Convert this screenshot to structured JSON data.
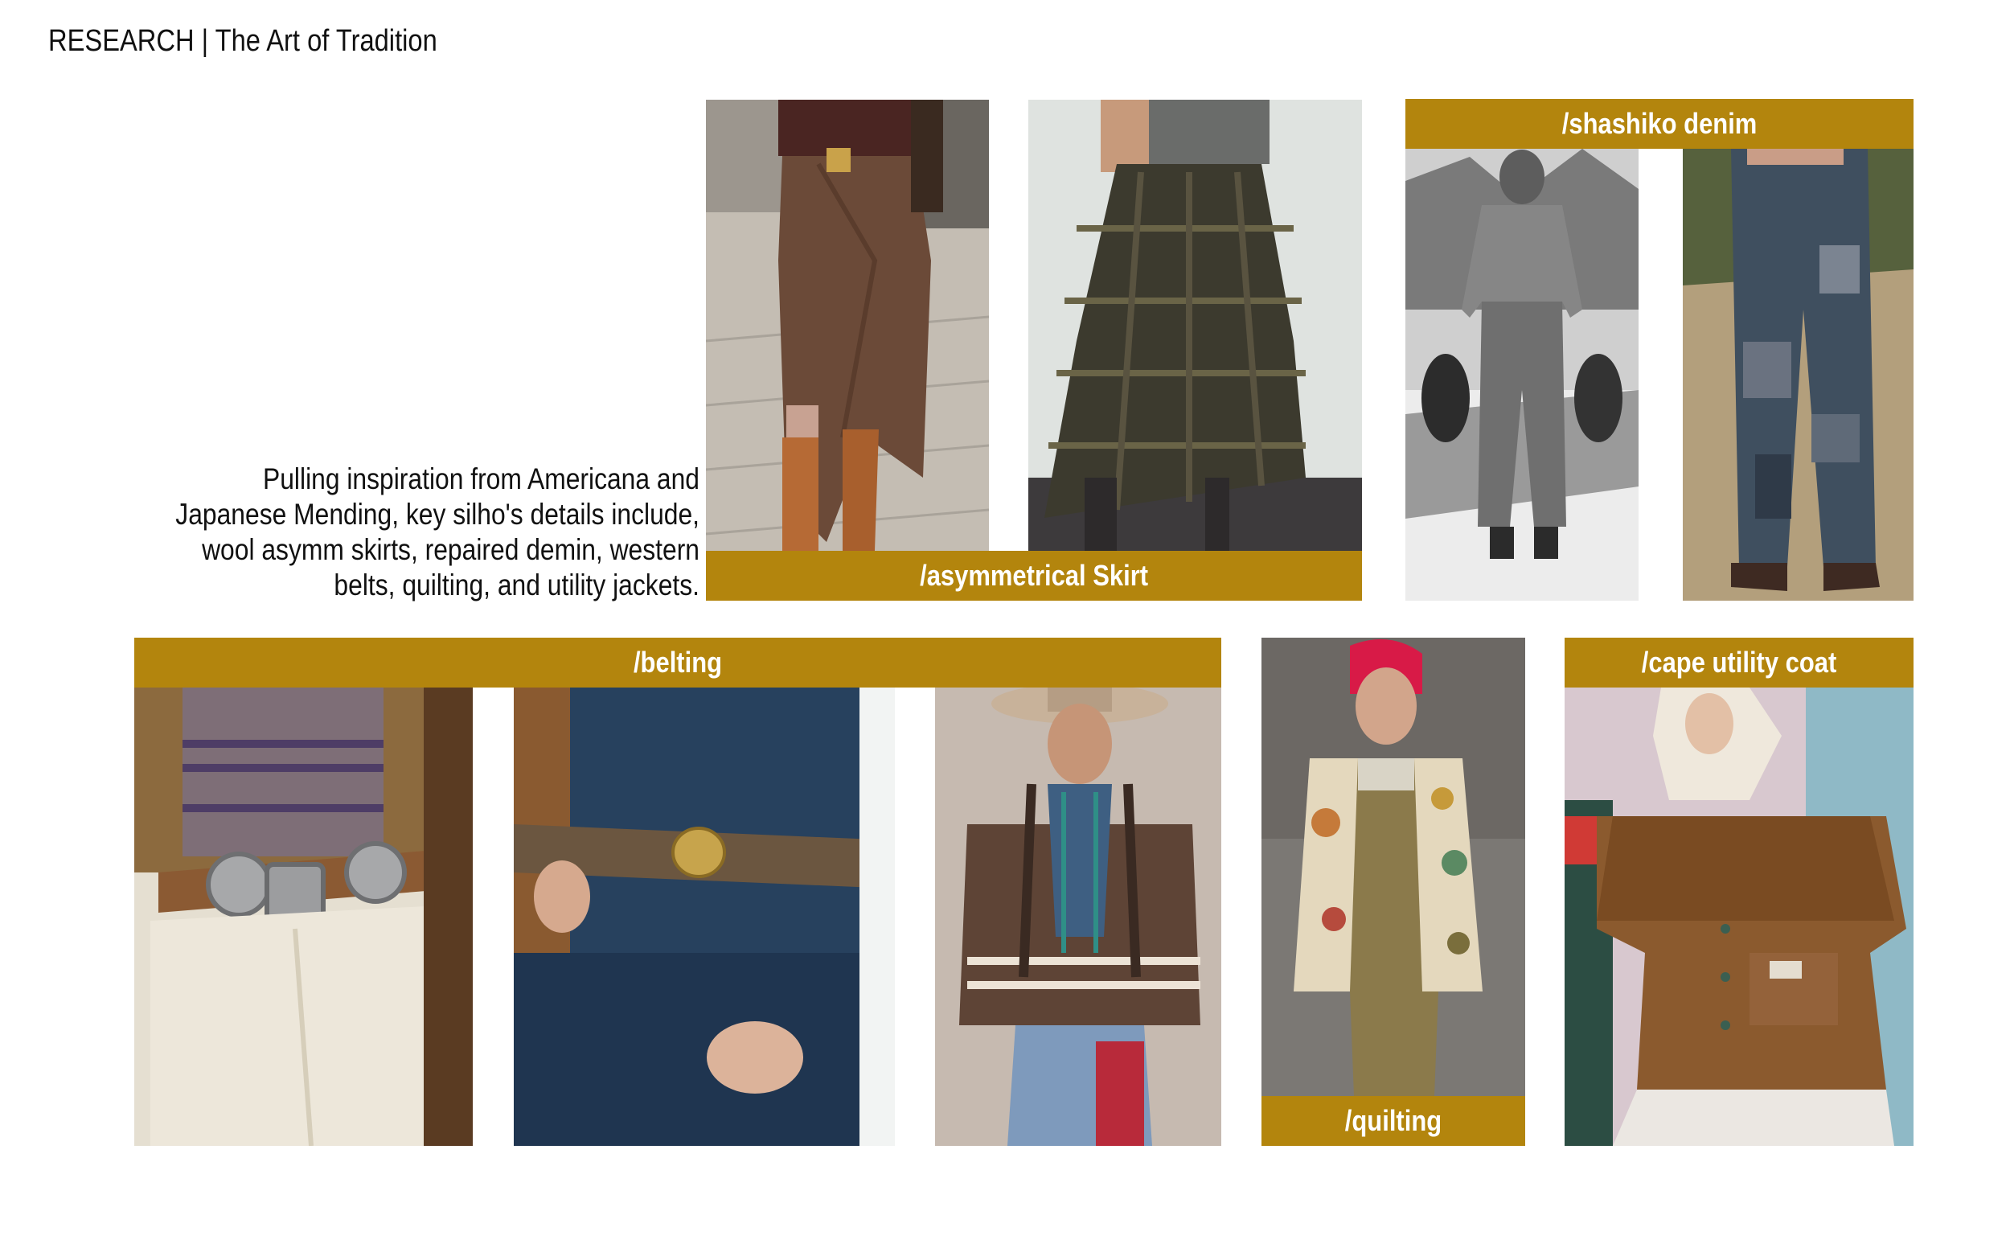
{
  "page": {
    "title": "RESEARCH | The Art of Tradition"
  },
  "intro": {
    "lines": [
      "Pulling inspiration from Americana and",
      "Japanese Mending, key silho's details include,",
      "wool asymm skirts, repaired demin, western",
      "belts, quilting, and utility jackets."
    ]
  },
  "labels": {
    "asymmetrical": "/asymmetrical Skirt",
    "shashiko": "/shashiko denim",
    "belting": "/belting",
    "quilting": "/quilting",
    "cape": "/cape utility coat"
  },
  "colors": {
    "label_bar": "#b3850d",
    "text": "#111111",
    "background": "#ffffff"
  }
}
